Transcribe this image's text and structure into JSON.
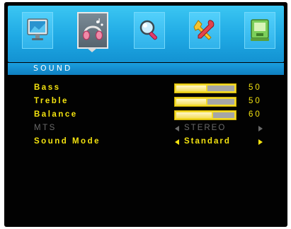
{
  "menu": {
    "tabs": [
      {
        "icon": "picture-monitor-icon",
        "selected": false
      },
      {
        "icon": "sound-headphones-icon",
        "selected": true
      },
      {
        "icon": "search-magnifier-icon",
        "selected": false
      },
      {
        "icon": "setup-tools-icon",
        "selected": false
      },
      {
        "icon": "lock-screen-icon",
        "selected": false
      }
    ],
    "section_title": "SOUND"
  },
  "items": {
    "bass": {
      "label": "Bass",
      "value": "50",
      "level": 0.5
    },
    "treble": {
      "label": "Treble",
      "value": "50",
      "level": 0.5
    },
    "balance": {
      "label": "Balance",
      "value": "60",
      "level": 0.6
    },
    "mts": {
      "label": "MTS",
      "option": "STEREO",
      "enabled": false
    },
    "sound_mode": {
      "label": "Sound Mode",
      "option": "Standard",
      "enabled": true
    }
  },
  "colors": {
    "highlight_text": "#f4e30f",
    "disabled_text": "#6a6a6a",
    "header_blue": "#1fa9e4",
    "background": "#020202"
  }
}
